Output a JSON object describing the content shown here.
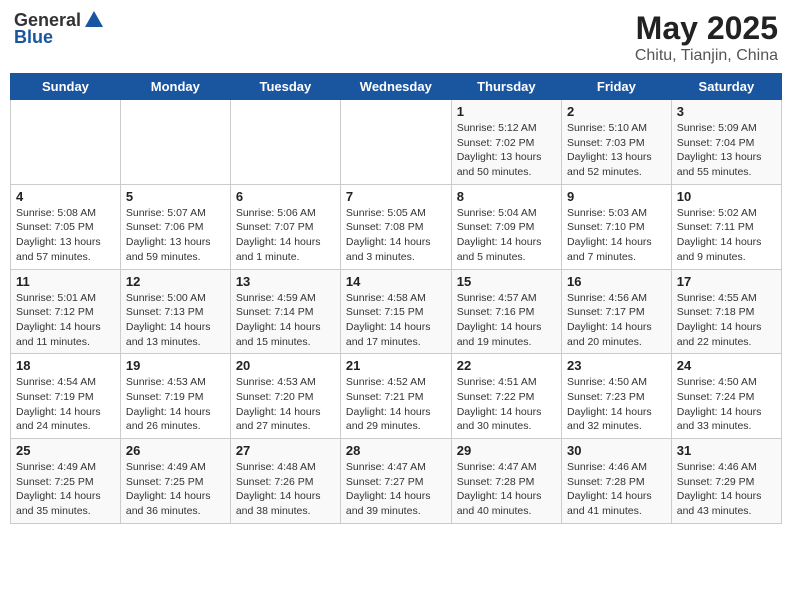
{
  "header": {
    "logo_line1": "General",
    "logo_line2": "Blue",
    "title": "May 2025",
    "subtitle": "Chitu, Tianjin, China"
  },
  "weekdays": [
    "Sunday",
    "Monday",
    "Tuesday",
    "Wednesday",
    "Thursday",
    "Friday",
    "Saturday"
  ],
  "weeks": [
    [
      {
        "day": "",
        "info": ""
      },
      {
        "day": "",
        "info": ""
      },
      {
        "day": "",
        "info": ""
      },
      {
        "day": "",
        "info": ""
      },
      {
        "day": "1",
        "info": "Sunrise: 5:12 AM\nSunset: 7:02 PM\nDaylight: 13 hours\nand 50 minutes."
      },
      {
        "day": "2",
        "info": "Sunrise: 5:10 AM\nSunset: 7:03 PM\nDaylight: 13 hours\nand 52 minutes."
      },
      {
        "day": "3",
        "info": "Sunrise: 5:09 AM\nSunset: 7:04 PM\nDaylight: 13 hours\nand 55 minutes."
      }
    ],
    [
      {
        "day": "4",
        "info": "Sunrise: 5:08 AM\nSunset: 7:05 PM\nDaylight: 13 hours\nand 57 minutes."
      },
      {
        "day": "5",
        "info": "Sunrise: 5:07 AM\nSunset: 7:06 PM\nDaylight: 13 hours\nand 59 minutes."
      },
      {
        "day": "6",
        "info": "Sunrise: 5:06 AM\nSunset: 7:07 PM\nDaylight: 14 hours\nand 1 minute."
      },
      {
        "day": "7",
        "info": "Sunrise: 5:05 AM\nSunset: 7:08 PM\nDaylight: 14 hours\nand 3 minutes."
      },
      {
        "day": "8",
        "info": "Sunrise: 5:04 AM\nSunset: 7:09 PM\nDaylight: 14 hours\nand 5 minutes."
      },
      {
        "day": "9",
        "info": "Sunrise: 5:03 AM\nSunset: 7:10 PM\nDaylight: 14 hours\nand 7 minutes."
      },
      {
        "day": "10",
        "info": "Sunrise: 5:02 AM\nSunset: 7:11 PM\nDaylight: 14 hours\nand 9 minutes."
      }
    ],
    [
      {
        "day": "11",
        "info": "Sunrise: 5:01 AM\nSunset: 7:12 PM\nDaylight: 14 hours\nand 11 minutes."
      },
      {
        "day": "12",
        "info": "Sunrise: 5:00 AM\nSunset: 7:13 PM\nDaylight: 14 hours\nand 13 minutes."
      },
      {
        "day": "13",
        "info": "Sunrise: 4:59 AM\nSunset: 7:14 PM\nDaylight: 14 hours\nand 15 minutes."
      },
      {
        "day": "14",
        "info": "Sunrise: 4:58 AM\nSunset: 7:15 PM\nDaylight: 14 hours\nand 17 minutes."
      },
      {
        "day": "15",
        "info": "Sunrise: 4:57 AM\nSunset: 7:16 PM\nDaylight: 14 hours\nand 19 minutes."
      },
      {
        "day": "16",
        "info": "Sunrise: 4:56 AM\nSunset: 7:17 PM\nDaylight: 14 hours\nand 20 minutes."
      },
      {
        "day": "17",
        "info": "Sunrise: 4:55 AM\nSunset: 7:18 PM\nDaylight: 14 hours\nand 22 minutes."
      }
    ],
    [
      {
        "day": "18",
        "info": "Sunrise: 4:54 AM\nSunset: 7:19 PM\nDaylight: 14 hours\nand 24 minutes."
      },
      {
        "day": "19",
        "info": "Sunrise: 4:53 AM\nSunset: 7:19 PM\nDaylight: 14 hours\nand 26 minutes."
      },
      {
        "day": "20",
        "info": "Sunrise: 4:53 AM\nSunset: 7:20 PM\nDaylight: 14 hours\nand 27 minutes."
      },
      {
        "day": "21",
        "info": "Sunrise: 4:52 AM\nSunset: 7:21 PM\nDaylight: 14 hours\nand 29 minutes."
      },
      {
        "day": "22",
        "info": "Sunrise: 4:51 AM\nSunset: 7:22 PM\nDaylight: 14 hours\nand 30 minutes."
      },
      {
        "day": "23",
        "info": "Sunrise: 4:50 AM\nSunset: 7:23 PM\nDaylight: 14 hours\nand 32 minutes."
      },
      {
        "day": "24",
        "info": "Sunrise: 4:50 AM\nSunset: 7:24 PM\nDaylight: 14 hours\nand 33 minutes."
      }
    ],
    [
      {
        "day": "25",
        "info": "Sunrise: 4:49 AM\nSunset: 7:25 PM\nDaylight: 14 hours\nand 35 minutes."
      },
      {
        "day": "26",
        "info": "Sunrise: 4:49 AM\nSunset: 7:25 PM\nDaylight: 14 hours\nand 36 minutes."
      },
      {
        "day": "27",
        "info": "Sunrise: 4:48 AM\nSunset: 7:26 PM\nDaylight: 14 hours\nand 38 minutes."
      },
      {
        "day": "28",
        "info": "Sunrise: 4:47 AM\nSunset: 7:27 PM\nDaylight: 14 hours\nand 39 minutes."
      },
      {
        "day": "29",
        "info": "Sunrise: 4:47 AM\nSunset: 7:28 PM\nDaylight: 14 hours\nand 40 minutes."
      },
      {
        "day": "30",
        "info": "Sunrise: 4:46 AM\nSunset: 7:28 PM\nDaylight: 14 hours\nand 41 minutes."
      },
      {
        "day": "31",
        "info": "Sunrise: 4:46 AM\nSunset: 7:29 PM\nDaylight: 14 hours\nand 43 minutes."
      }
    ]
  ]
}
